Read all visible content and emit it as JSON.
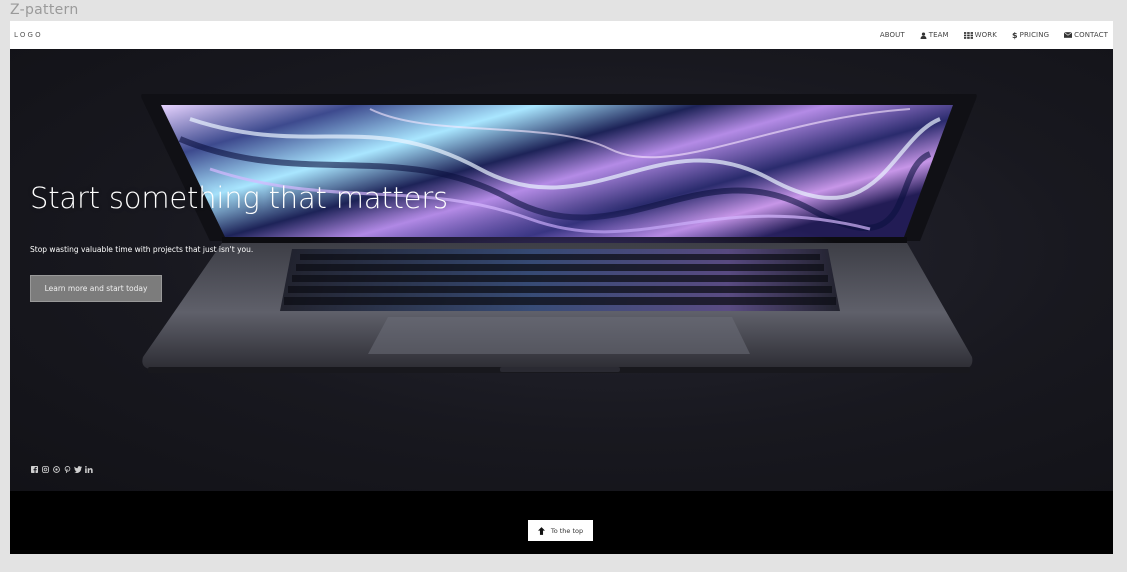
{
  "page": {
    "title": "Z-pattern"
  },
  "navbar": {
    "logo": "LOGO",
    "links": [
      {
        "label": "ABOUT",
        "icon": ""
      },
      {
        "label": "TEAM",
        "icon": "user-icon"
      },
      {
        "label": "WORK",
        "icon": "grid-icon"
      },
      {
        "label": "PRICING",
        "icon": "dollar-icon"
      },
      {
        "label": "CONTACT",
        "icon": "envelope-icon"
      }
    ]
  },
  "hero": {
    "headline": "Start something that matters",
    "subheadline": "Stop wasting valuable time with projects that just isn't you.",
    "cta_label": "Learn more and start today",
    "socials": [
      "facebook-icon",
      "instagram-icon",
      "snapchat-icon",
      "pinterest-icon",
      "twitter-icon",
      "linkedin-icon"
    ]
  },
  "footer": {
    "to_top_label": "To the top"
  },
  "colors": {
    "hero_bg": "#18181f",
    "cta_bg": "#7c7c7c",
    "footer_bg": "#000000",
    "navbar_bg": "#ffffff"
  }
}
